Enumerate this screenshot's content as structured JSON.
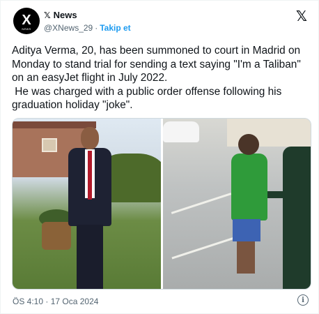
{
  "account": {
    "avatar_logo": "X",
    "avatar_sub": "NEWS",
    "name_icon": "𝕏",
    "display_name": "News",
    "handle": "@XNews_29",
    "separator": "·",
    "follow_label": "Takip et"
  },
  "brand_logo": "𝕏",
  "tweet": {
    "text_line1": "Aditya Verma, 20, has been summoned to court in Madrid on Monday to stand trial for sending a text saying \"I'm a Taliban\" on an easyJet flight in July 2022.",
    "text_line2": " He was charged with a public order offense following his graduation holiday \"joke\"."
  },
  "media": {
    "images": [
      "photo-young-man-in-suit-garden",
      "photo-man-escorted-by-police-on-street"
    ]
  },
  "footer": {
    "timestamp": "ÖS 4:10 · 17 Oca 2024",
    "info_glyph": "i"
  }
}
